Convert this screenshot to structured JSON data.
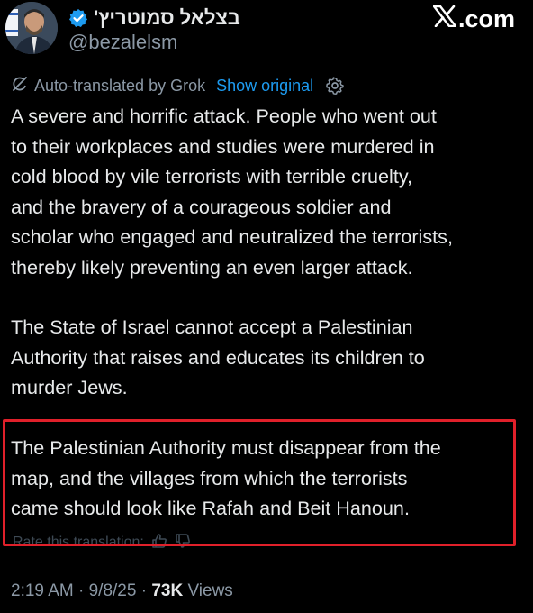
{
  "header": {
    "display_name": "בצלאל סמוטריץ'",
    "handle": "@bezalelsm",
    "brand": ".com",
    "brand_icon": "x-logo-icon",
    "verified_color": "#1d9bf0"
  },
  "translation": {
    "label": "Auto-translated by Grok",
    "show_original": "Show original",
    "icon": "gear-icon"
  },
  "post": {
    "paragraphs": [
      " A severe and horrific attack. People who went out\nto their workplaces and studies were murdered in\ncold blood by vile terrorists with terrible cruelty,\nand the bravery of a courageous soldier and\nscholar who engaged and neutralized the terrorists,\nthereby likely preventing an even larger attack.",
      "The State of Israel cannot accept a Palestinian\nAuthority that raises and educates its children to\nmurder Jews.",
      "The Palestinian Authority must disappear from the\nmap, and the villages from which the terrorists\ncame should look like Rafah and Beit Hanoun."
    ],
    "highlight_color": "#e0202a"
  },
  "rate": {
    "label": "Rate this translation:"
  },
  "meta": {
    "time": "2:19 AM",
    "separator": " · ",
    "date": "9/8/25",
    "views_count": "73K",
    "views_label": " Views"
  }
}
